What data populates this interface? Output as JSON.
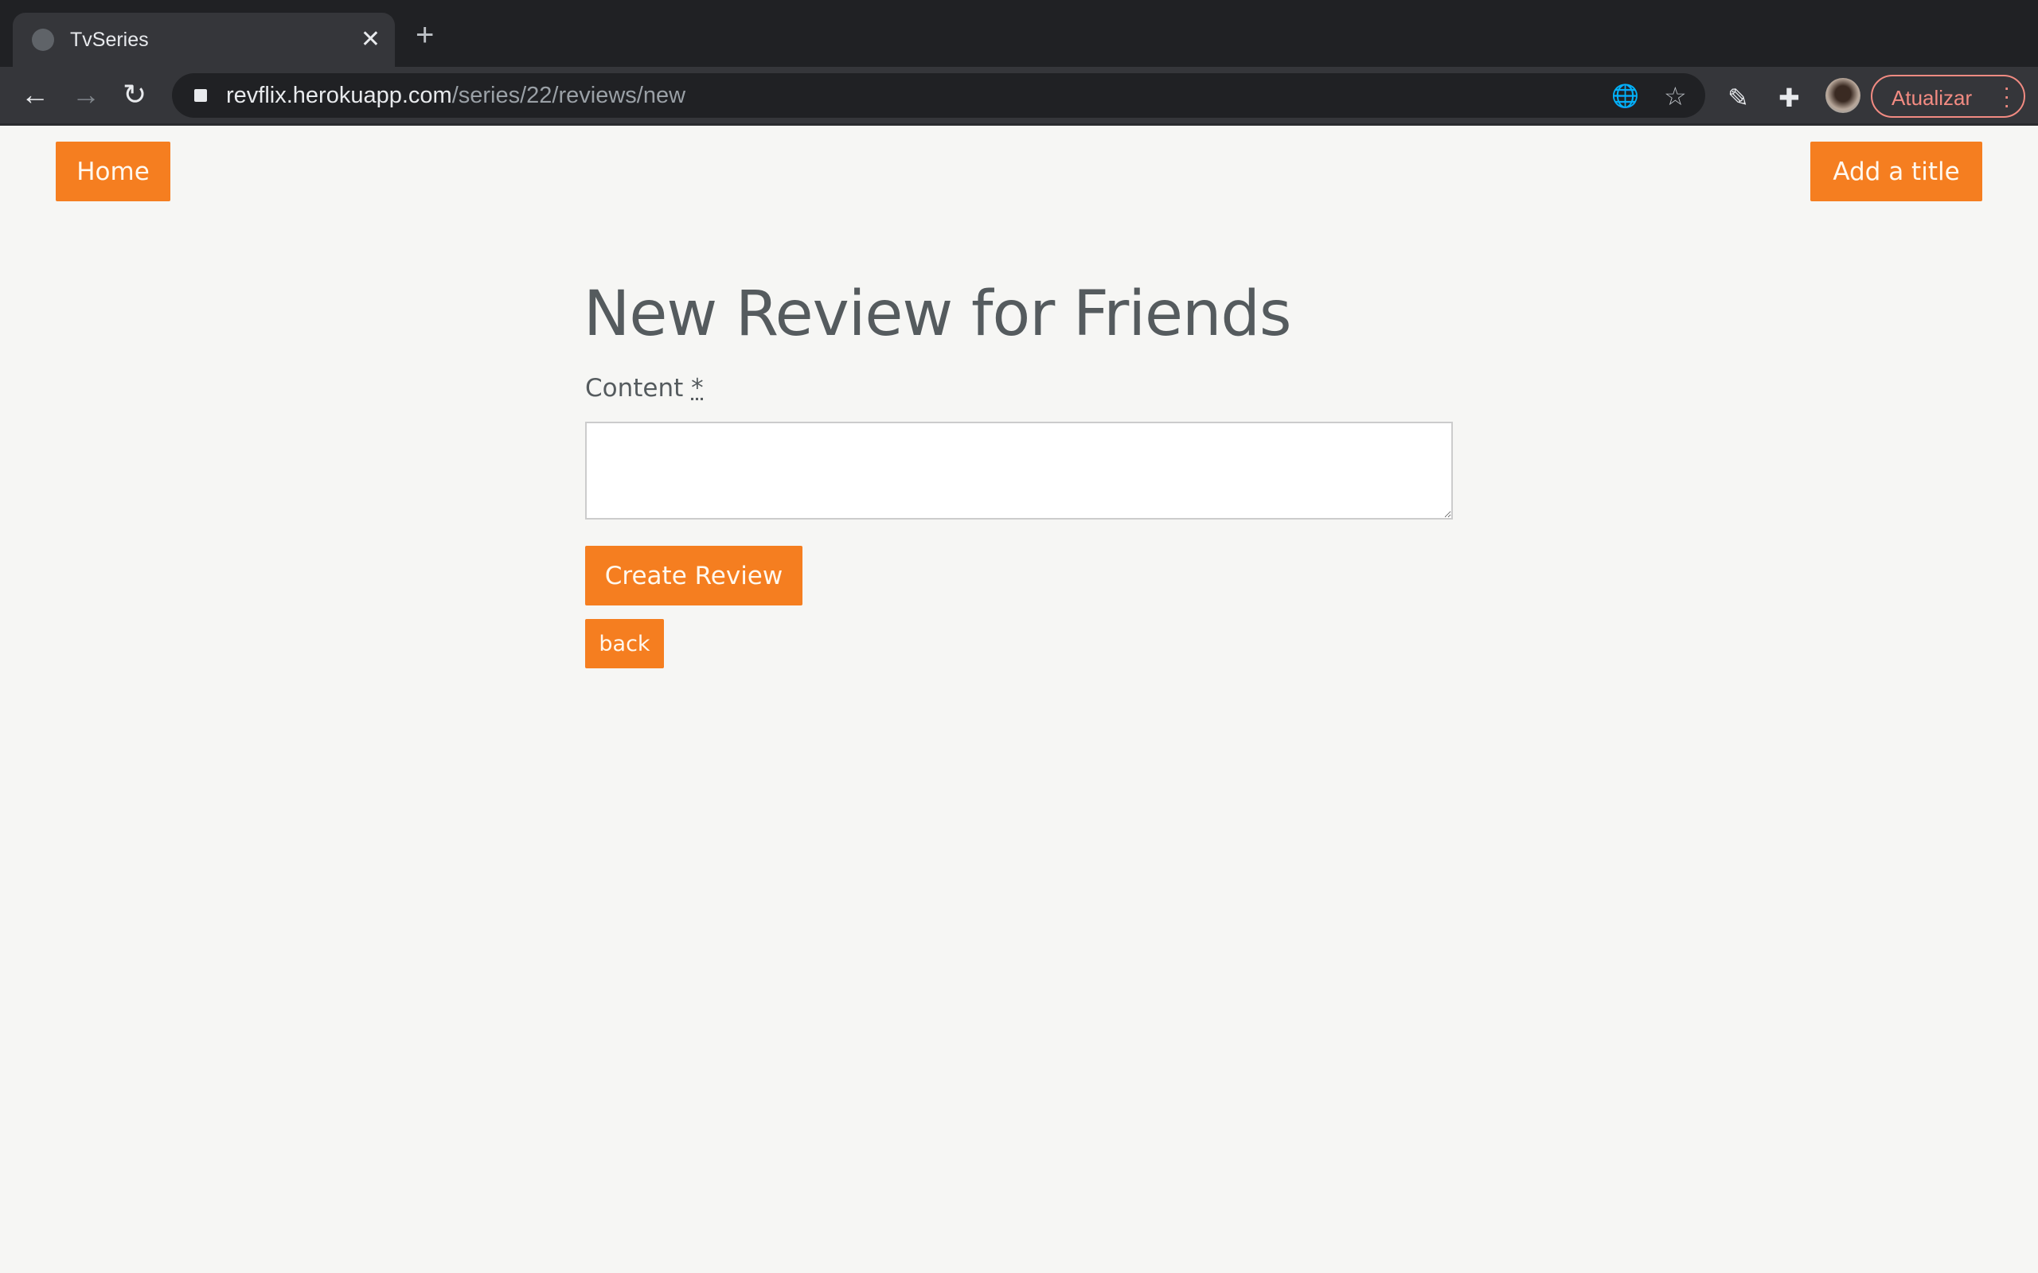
{
  "browser": {
    "tab_title": "TvSeries",
    "url_host": "revflix.herokuapp.com",
    "url_path": "/series/22/reviews/new",
    "update_label": "Atualizar"
  },
  "nav": {
    "home": "Home",
    "add_title": "Add a title"
  },
  "form": {
    "heading": "New Review for Friends",
    "content_label": "Content",
    "required_mark": "*",
    "content_value": "",
    "submit": "Create Review",
    "back": "back"
  },
  "colors": {
    "accent": "#f57e20"
  }
}
